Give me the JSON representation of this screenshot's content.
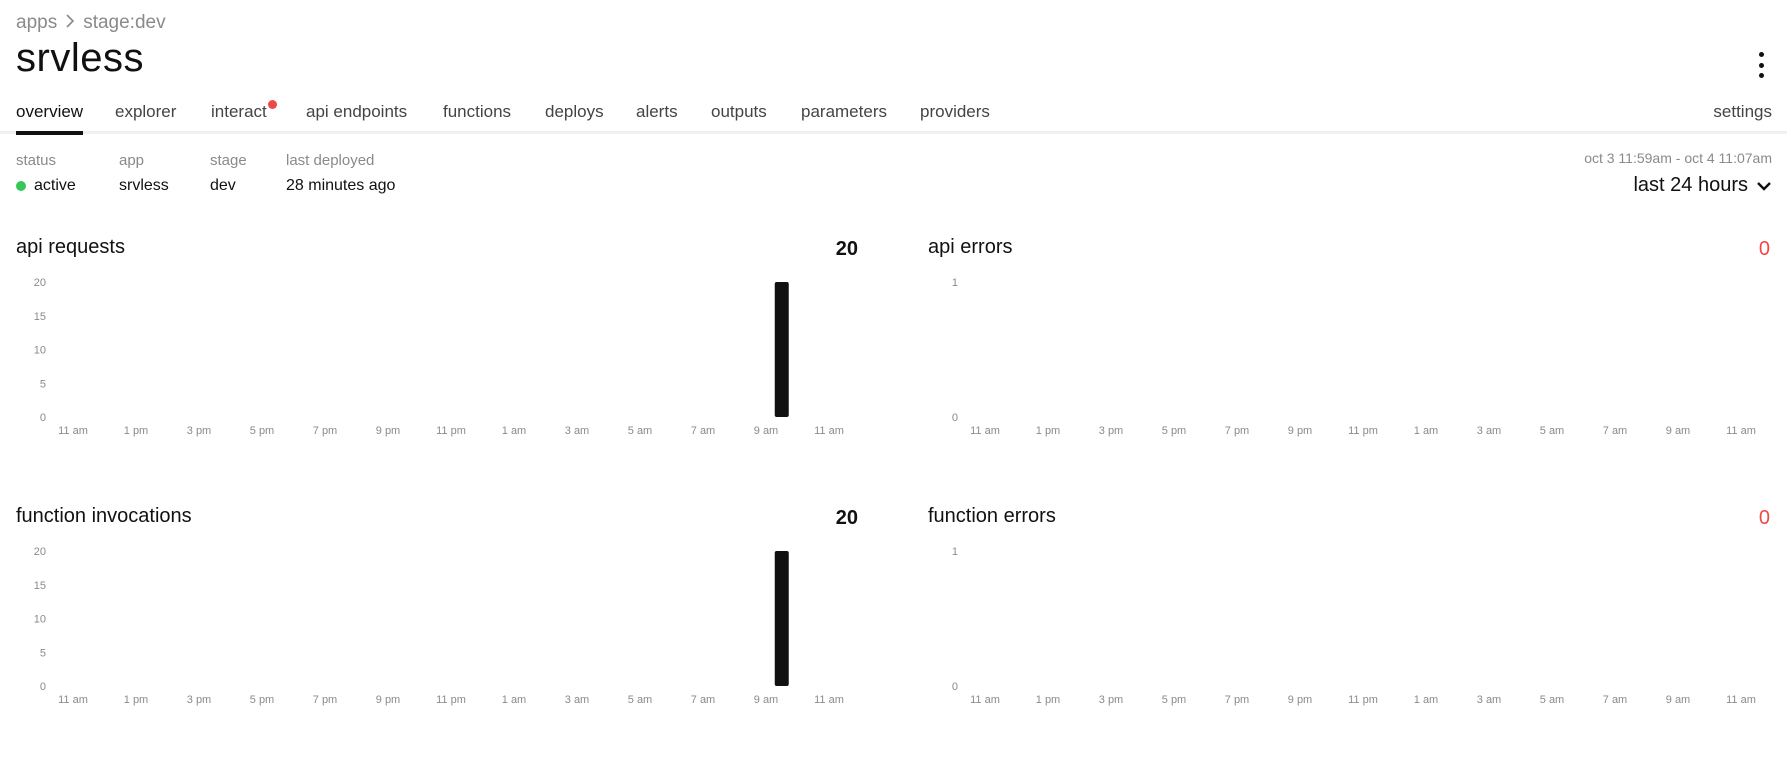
{
  "breadcrumb": {
    "items": [
      "apps",
      "stage:dev"
    ]
  },
  "page_title": "srvless",
  "tabs": [
    {
      "label": "overview",
      "active": true
    },
    {
      "label": "explorer"
    },
    {
      "label": "interact",
      "notification": true
    },
    {
      "label": "api endpoints"
    },
    {
      "label": "functions"
    },
    {
      "label": "deploys"
    },
    {
      "label": "alerts"
    },
    {
      "label": "outputs"
    },
    {
      "label": "parameters"
    },
    {
      "label": "providers"
    }
  ],
  "settings_label": "settings",
  "meta": {
    "status": {
      "label": "status",
      "value": "active",
      "color": "#35c75a"
    },
    "app": {
      "label": "app",
      "value": "srvless"
    },
    "stage": {
      "label": "stage",
      "value": "dev"
    },
    "last_deployed": {
      "label": "last deployed",
      "value": "28 minutes ago"
    }
  },
  "time_range": {
    "subtitle": "oct 3 11:59am - oct 4 11:07am",
    "selected": "last 24 hours"
  },
  "colors": {
    "accent": "#111111",
    "error": "#f04848",
    "status_active": "#35c75a",
    "muted": "#8a8a8a"
  },
  "panels": [
    {
      "title": "api requests",
      "total": "20",
      "is_error": false
    },
    {
      "title": "api errors",
      "total": "0",
      "is_error": true
    },
    {
      "title": "function invocations",
      "total": "20",
      "is_error": false
    },
    {
      "title": "function errors",
      "total": "0",
      "is_error": true
    }
  ],
  "chart_data": [
    {
      "type": "bar",
      "x_ticks": [
        "11 am",
        "1 pm",
        "3 pm",
        "5 pm",
        "7 pm",
        "9 pm",
        "11 pm",
        "1 am",
        "3 am",
        "5 am",
        "7 am",
        "9 am",
        "11 am"
      ],
      "y_ticks": [
        0,
        5,
        10,
        15,
        20
      ],
      "ylim": [
        0,
        20
      ],
      "bars": [
        {
          "x_hour": 22.5,
          "value": 20
        }
      ],
      "color": "#111111"
    },
    {
      "type": "bar",
      "x_ticks": [
        "11 am",
        "1 pm",
        "3 pm",
        "5 pm",
        "7 pm",
        "9 pm",
        "11 pm",
        "1 am",
        "3 am",
        "5 am",
        "7 am",
        "9 am",
        "11 am"
      ],
      "y_ticks": [
        0,
        1
      ],
      "ylim": [
        0,
        1
      ],
      "bars": [],
      "color": "#f04848"
    },
    {
      "type": "bar",
      "x_ticks": [
        "11 am",
        "1 pm",
        "3 pm",
        "5 pm",
        "7 pm",
        "9 pm",
        "11 pm",
        "1 am",
        "3 am",
        "5 am",
        "7 am",
        "9 am",
        "11 am"
      ],
      "y_ticks": [
        0,
        5,
        10,
        15,
        20
      ],
      "ylim": [
        0,
        20
      ],
      "bars": [
        {
          "x_hour": 22.5,
          "value": 20
        }
      ],
      "color": "#111111"
    },
    {
      "type": "bar",
      "x_ticks": [
        "11 am",
        "1 pm",
        "3 pm",
        "5 pm",
        "7 pm",
        "9 pm",
        "11 pm",
        "1 am",
        "3 am",
        "5 am",
        "7 am",
        "9 am",
        "11 am"
      ],
      "y_ticks": [
        0,
        1
      ],
      "ylim": [
        0,
        1
      ],
      "bars": [],
      "color": "#f04848"
    }
  ]
}
